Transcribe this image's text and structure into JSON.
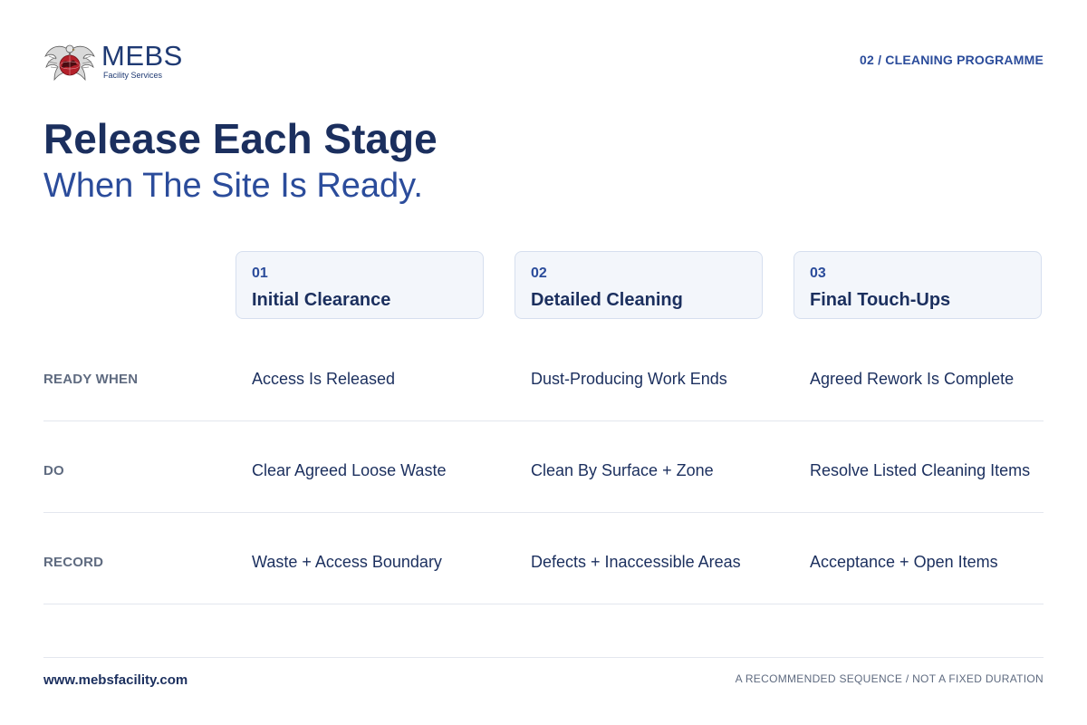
{
  "logo": {
    "name": "MEBS",
    "subtitle": "Facility Services",
    "icon": "eagle-globe-emblem-icon"
  },
  "header": {
    "section_label": "02 / CLEANING PROGRAMME"
  },
  "heading": {
    "title": "Release Each Stage",
    "subtitle": "When The Site Is Ready."
  },
  "stages": [
    {
      "number": "01",
      "title": "Initial Clearance"
    },
    {
      "number": "02",
      "title": "Detailed Cleaning"
    },
    {
      "number": "03",
      "title": "Final Touch-Ups"
    }
  ],
  "rows": [
    {
      "label": "READY WHEN",
      "cells": [
        "Access Is Released",
        "Dust-Producing Work Ends",
        "Agreed Rework Is Complete"
      ]
    },
    {
      "label": "DO",
      "cells": [
        "Clear Agreed Loose Waste",
        "Clean By Surface + Zone",
        "Resolve Listed Cleaning Items"
      ]
    },
    {
      "label": "RECORD",
      "cells": [
        "Waste + Access Boundary",
        "Defects + Inaccessible Areas",
        "Acceptance + Open Items"
      ]
    }
  ],
  "footer": {
    "url": "www.mebsfacility.com",
    "note": "A RECOMMENDED SEQUENCE / NOT A FIXED DURATION"
  },
  "colors": {
    "navy": "#1b2f5e",
    "accent_blue": "#2b4c9b",
    "muted_gray": "#5f6b80",
    "card_bg": "#f3f6fb",
    "emblem_red": "#b3202a"
  }
}
